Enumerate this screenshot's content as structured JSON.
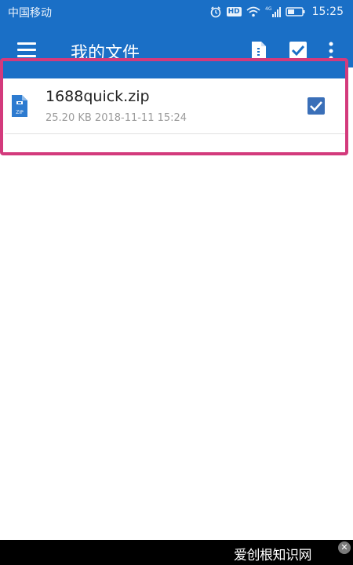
{
  "status_bar": {
    "carrier": "中国移动",
    "hd_badge": "HD",
    "network": "4G",
    "time": "15:25",
    "icons": [
      "alarm-icon",
      "wifi-icon",
      "signal-icon",
      "battery-icon"
    ]
  },
  "app_bar": {
    "title": "我的文件",
    "actions": [
      "menu-icon",
      "new-file-icon",
      "select-all-icon",
      "more-icon"
    ]
  },
  "files": [
    {
      "name": "1688quick.zip",
      "meta": "25.20 KB  2018-11-11 15:24",
      "icon": "zip-file-icon",
      "icon_label": "ZIP",
      "checked": true
    }
  ],
  "watermark": {
    "text": "爱创根知识网",
    "close_glyph": "✕"
  },
  "colors": {
    "primary": "#1a6fc6",
    "highlight": "#d33a7c",
    "checkbox": "#3a6fb8"
  }
}
